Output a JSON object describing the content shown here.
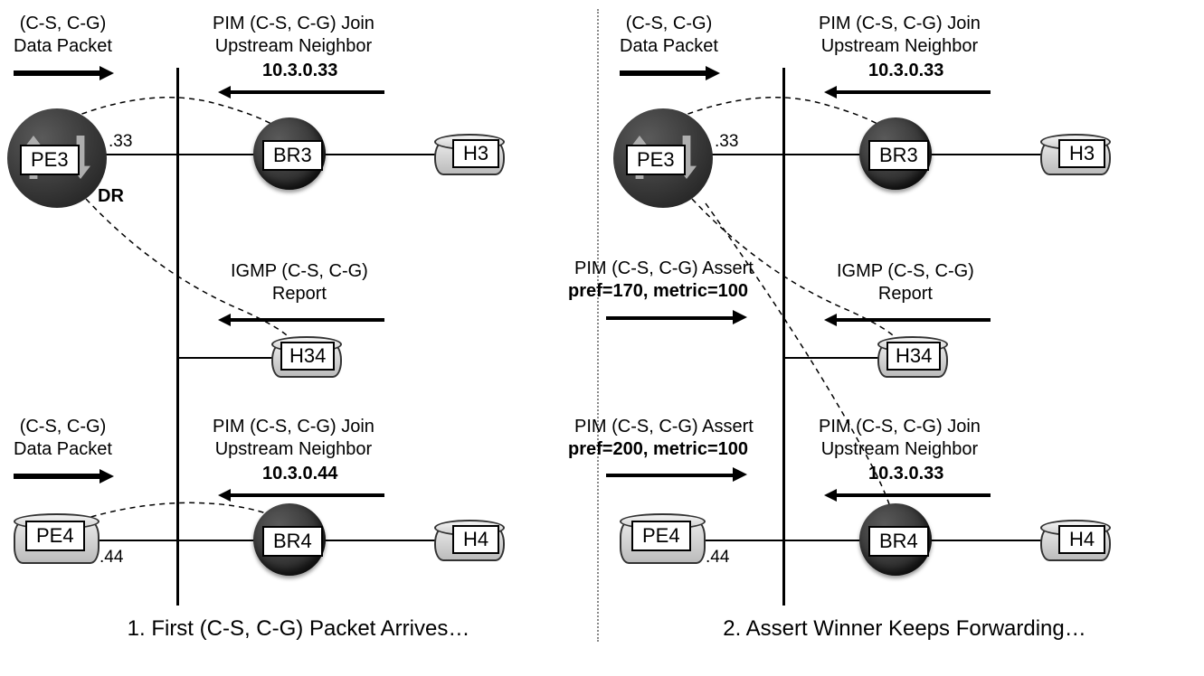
{
  "left": {
    "caption": "1. First (C-S, C-G) Packet Arrives…",
    "pe3": {
      "label": "PE3",
      "ip": ".33",
      "dr": "DR",
      "pkt_title": "(C-S, C-G)\nData Packet"
    },
    "pe4": {
      "label": "PE4",
      "ip": ".44",
      "pkt_title": "(C-S, C-G)\nData Packet"
    },
    "br3": {
      "label": "BR3",
      "join": "PIM (C-S, C-G) Join\nUpstream Neighbor",
      "join_ip": "10.3.0.33"
    },
    "br4": {
      "label": "BR4",
      "join": "PIM (C-S, C-G) Join\nUpstream Neighbor",
      "join_ip": "10.3.0.44"
    },
    "h3": "H3",
    "h4": "H4",
    "h34": "H34",
    "igmp": "IGMP (C-S, C-G)\nReport"
  },
  "right": {
    "caption": "2. Assert Winner Keeps Forwarding…",
    "pe3": {
      "label": "PE3",
      "ip": ".33",
      "pkt_title": "(C-S, C-G)\nData Packet",
      "assert": "PIM (C-S, C-G) Assert",
      "assert_val": "pref=170, metric=100"
    },
    "pe4": {
      "label": "PE4",
      "ip": ".44",
      "assert": "PIM (C-S, C-G) Assert",
      "assert_val": "pref=200, metric=100"
    },
    "br3": {
      "label": "BR3",
      "join": "PIM (C-S, C-G) Join\nUpstream Neighbor",
      "join_ip": "10.3.0.33"
    },
    "br4": {
      "label": "BR4",
      "join": "PIM (C-S, C-G) Join\nUpstream Neighbor",
      "join_ip": "10.3.0.33"
    },
    "h3": "H3",
    "h4": "H4",
    "h34": "H34",
    "igmp": "IGMP (C-S, C-G)\nReport"
  }
}
